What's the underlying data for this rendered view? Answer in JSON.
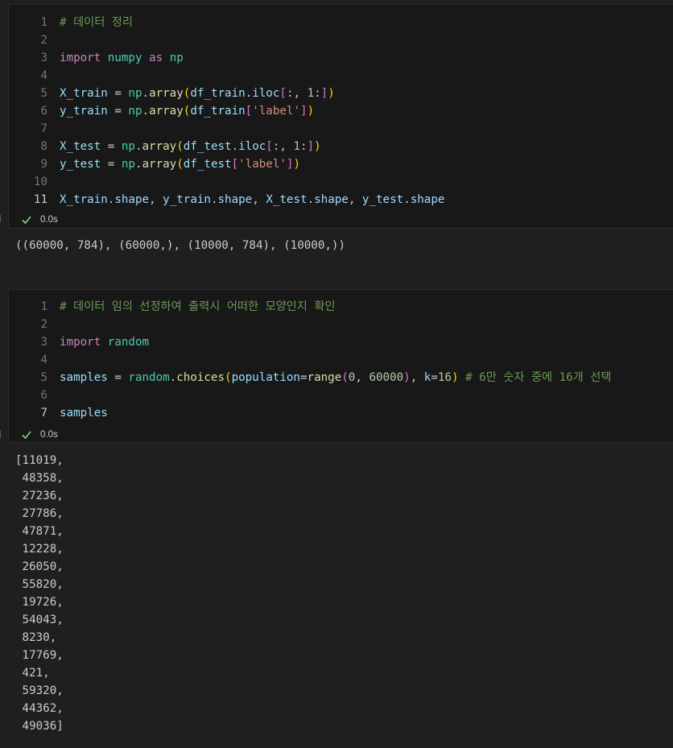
{
  "cell1": {
    "lines": [
      {
        "n": "1",
        "tokens": [
          {
            "t": "# 데이터 정리",
            "c": "comment"
          }
        ]
      },
      {
        "n": "2",
        "tokens": []
      },
      {
        "n": "3",
        "tokens": [
          {
            "t": "import",
            "c": "kw"
          },
          {
            "t": " ",
            "c": "plain"
          },
          {
            "t": "numpy",
            "c": "mod"
          },
          {
            "t": " ",
            "c": "plain"
          },
          {
            "t": "as",
            "c": "kw"
          },
          {
            "t": " ",
            "c": "plain"
          },
          {
            "t": "np",
            "c": "mod"
          }
        ]
      },
      {
        "n": "4",
        "tokens": []
      },
      {
        "n": "5",
        "tokens": [
          {
            "t": "X_train",
            "c": "var"
          },
          {
            "t": " = ",
            "c": "plain"
          },
          {
            "t": "np",
            "c": "mod"
          },
          {
            "t": ".",
            "c": "plain"
          },
          {
            "t": "array",
            "c": "fn"
          },
          {
            "t": "(",
            "c": "br1"
          },
          {
            "t": "df_train",
            "c": "var"
          },
          {
            "t": ".",
            "c": "plain"
          },
          {
            "t": "iloc",
            "c": "var"
          },
          {
            "t": "[",
            "c": "br2"
          },
          {
            "t": ":, ",
            "c": "plain"
          },
          {
            "t": "1",
            "c": "num"
          },
          {
            "t": ":",
            "c": "plain"
          },
          {
            "t": "]",
            "c": "br2"
          },
          {
            "t": ")",
            "c": "br1"
          }
        ]
      },
      {
        "n": "6",
        "tokens": [
          {
            "t": "y_train",
            "c": "var"
          },
          {
            "t": " = ",
            "c": "plain"
          },
          {
            "t": "np",
            "c": "mod"
          },
          {
            "t": ".",
            "c": "plain"
          },
          {
            "t": "array",
            "c": "fn"
          },
          {
            "t": "(",
            "c": "br1"
          },
          {
            "t": "df_train",
            "c": "var"
          },
          {
            "t": "[",
            "c": "br2"
          },
          {
            "t": "'label'",
            "c": "str"
          },
          {
            "t": "]",
            "c": "br2"
          },
          {
            "t": ")",
            "c": "br1"
          }
        ]
      },
      {
        "n": "7",
        "tokens": []
      },
      {
        "n": "8",
        "tokens": [
          {
            "t": "X_test",
            "c": "var"
          },
          {
            "t": " = ",
            "c": "plain"
          },
          {
            "t": "np",
            "c": "mod"
          },
          {
            "t": ".",
            "c": "plain"
          },
          {
            "t": "array",
            "c": "fn"
          },
          {
            "t": "(",
            "c": "br1"
          },
          {
            "t": "df_test",
            "c": "var"
          },
          {
            "t": ".",
            "c": "plain"
          },
          {
            "t": "iloc",
            "c": "var"
          },
          {
            "t": "[",
            "c": "br2"
          },
          {
            "t": ":, ",
            "c": "plain"
          },
          {
            "t": "1",
            "c": "num"
          },
          {
            "t": ":",
            "c": "plain"
          },
          {
            "t": "]",
            "c": "br2"
          },
          {
            "t": ")",
            "c": "br1"
          }
        ]
      },
      {
        "n": "9",
        "tokens": [
          {
            "t": "y_test",
            "c": "var"
          },
          {
            "t": " = ",
            "c": "plain"
          },
          {
            "t": "np",
            "c": "mod"
          },
          {
            "t": ".",
            "c": "plain"
          },
          {
            "t": "array",
            "c": "fn"
          },
          {
            "t": "(",
            "c": "br1"
          },
          {
            "t": "df_test",
            "c": "var"
          },
          {
            "t": "[",
            "c": "br2"
          },
          {
            "t": "'label'",
            "c": "str"
          },
          {
            "t": "]",
            "c": "br2"
          },
          {
            "t": ")",
            "c": "br1"
          }
        ]
      },
      {
        "n": "10",
        "tokens": []
      },
      {
        "n": "11",
        "active": true,
        "tokens": [
          {
            "t": "X_train",
            "c": "var"
          },
          {
            "t": ".",
            "c": "plain"
          },
          {
            "t": "shape",
            "c": "var"
          },
          {
            "t": ", ",
            "c": "plain"
          },
          {
            "t": "y_train",
            "c": "var"
          },
          {
            "t": ".",
            "c": "plain"
          },
          {
            "t": "shape",
            "c": "var"
          },
          {
            "t": ", ",
            "c": "plain"
          },
          {
            "t": "X_test",
            "c": "var"
          },
          {
            "t": ".",
            "c": "plain"
          },
          {
            "t": "shape",
            "c": "var"
          },
          {
            "t": ", ",
            "c": "plain"
          },
          {
            "t": "y_test",
            "c": "var"
          },
          {
            "t": ".",
            "c": "plain"
          },
          {
            "t": "shape",
            "c": "var"
          }
        ]
      }
    ],
    "status": "0.0s",
    "output": "((60000, 784), (60000,), (10000, 784), (10000,))"
  },
  "cell2": {
    "lines": [
      {
        "n": "1",
        "tokens": [
          {
            "t": "# 데이터 임의 선정하여 출력시 어떠한 모양인지 확인",
            "c": "comment"
          }
        ]
      },
      {
        "n": "2",
        "tokens": []
      },
      {
        "n": "3",
        "tokens": [
          {
            "t": "import",
            "c": "kw"
          },
          {
            "t": " ",
            "c": "plain"
          },
          {
            "t": "random",
            "c": "mod"
          }
        ]
      },
      {
        "n": "4",
        "tokens": []
      },
      {
        "n": "5",
        "tokens": [
          {
            "t": "samples",
            "c": "var"
          },
          {
            "t": " = ",
            "c": "plain"
          },
          {
            "t": "random",
            "c": "mod"
          },
          {
            "t": ".",
            "c": "plain"
          },
          {
            "t": "choices",
            "c": "fn"
          },
          {
            "t": "(",
            "c": "br1"
          },
          {
            "t": "population",
            "c": "var"
          },
          {
            "t": "=",
            "c": "plain"
          },
          {
            "t": "range",
            "c": "fn"
          },
          {
            "t": "(",
            "c": "br2"
          },
          {
            "t": "0",
            "c": "num"
          },
          {
            "t": ", ",
            "c": "plain"
          },
          {
            "t": "60000",
            "c": "num"
          },
          {
            "t": ")",
            "c": "br2"
          },
          {
            "t": ", ",
            "c": "plain"
          },
          {
            "t": "k",
            "c": "var"
          },
          {
            "t": "=",
            "c": "plain"
          },
          {
            "t": "16",
            "c": "num"
          },
          {
            "t": ")",
            "c": "br1"
          },
          {
            "t": " ",
            "c": "plain"
          },
          {
            "t": "# 6만 숫자 중에 16개 선택",
            "c": "comment"
          }
        ]
      },
      {
        "n": "6",
        "tokens": []
      },
      {
        "n": "7",
        "active": true,
        "tokens": [
          {
            "t": "samples",
            "c": "var"
          }
        ]
      }
    ],
    "status": "0.0s",
    "output_lines": [
      "[11019,",
      " 48358,",
      " 27236,",
      " 27786,",
      " 47871,",
      " 12228,",
      " 26050,",
      " 55820,",
      " 19726,",
      " 54043,",
      " 8230,",
      " 17769,",
      " 421,",
      " 59320,",
      " 44362,",
      " 49036]"
    ]
  },
  "icons": {
    "status_ok": "check-icon"
  },
  "colors": {
    "success": "#89d185",
    "background": "#1f1f1f",
    "cell_background": "#181818"
  }
}
